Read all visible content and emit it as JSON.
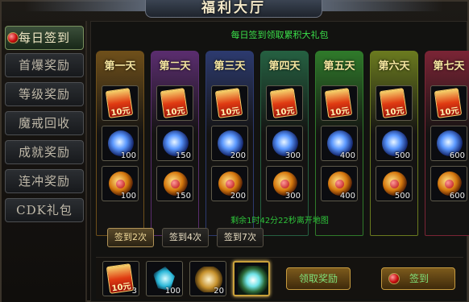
{
  "window": {
    "title": "福利大厅"
  },
  "sidebar": {
    "items": [
      {
        "label": "每日签到",
        "active": true
      },
      {
        "label": "首爆奖励"
      },
      {
        "label": "等级奖励"
      },
      {
        "label": "魔戒回收"
      },
      {
        "label": "成就奖励"
      },
      {
        "label": "连冲奖励"
      },
      {
        "label": "CDK礼包"
      }
    ]
  },
  "main": {
    "subtitle": "每日签到领取累积大礼包",
    "days": [
      {
        "label": "第一天",
        "theme_color": "#6e4f1a",
        "packet_text": "10元",
        "swirl_count": "100",
        "gem_count": "100"
      },
      {
        "label": "第二天",
        "theme_color": "#5a2d6e",
        "packet_text": "10元",
        "swirl_count": "150",
        "gem_count": "150"
      },
      {
        "label": "第三天",
        "theme_color": "#2c3a6e",
        "packet_text": "10元",
        "swirl_count": "200",
        "gem_count": "200"
      },
      {
        "label": "第四天",
        "theme_color": "#256041",
        "packet_text": "10元",
        "swirl_count": "300",
        "gem_count": "300"
      },
      {
        "label": "第五天",
        "theme_color": "#2f7a2a",
        "packet_text": "10元",
        "swirl_count": "400",
        "gem_count": "400"
      },
      {
        "label": "第六天",
        "theme_color": "#6a7a1f",
        "packet_text": "10元",
        "swirl_count": "500",
        "gem_count": "500"
      },
      {
        "label": "第七天",
        "theme_color": "#7a2435",
        "packet_text": "10元",
        "swirl_count": "600",
        "gem_count": "600"
      }
    ],
    "timer_text": "剩余1时42分22秒离开地图",
    "tabs": [
      {
        "label": "签到2次",
        "active": true
      },
      {
        "label": "签到4次"
      },
      {
        "label": "签到7次"
      }
    ],
    "bottom_items": [
      {
        "icon": "red-packet-icon",
        "text": "10元",
        "count": "3"
      },
      {
        "icon": "blue-shard-icon",
        "count": "100"
      },
      {
        "icon": "treasure-icon",
        "count": "20"
      },
      {
        "icon": "dragon-icon",
        "count": ""
      }
    ],
    "claim_button": "领取奖励",
    "sign_button": "签到"
  }
}
